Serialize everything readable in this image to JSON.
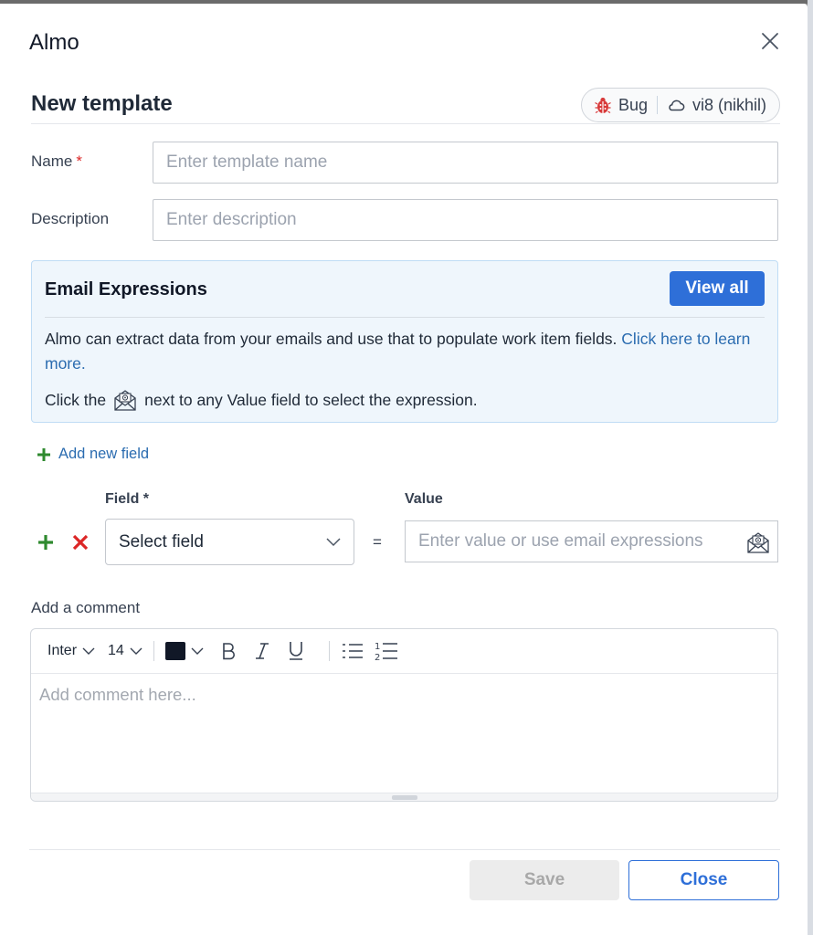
{
  "dialog": {
    "app_title": "Almo",
    "page_title": "New template",
    "context": {
      "item_type": "Bug",
      "item_type_icon": "bug-icon",
      "project": "vi8 (nikhil)",
      "project_icon": "cloud-icon"
    }
  },
  "form": {
    "name_label": "Name",
    "required_marker": "*",
    "name_placeholder": "Enter template name",
    "description_label": "Description",
    "description_placeholder": "Enter description"
  },
  "email_expressions": {
    "title": "Email Expressions",
    "view_all_label": "View all",
    "body_text": "Almo can extract data from your emails and use that to populate work item fields.",
    "link_text": "Click here to learn more.",
    "hint_prefix": "Click the",
    "hint_suffix": "next to any Value field to select the expression.",
    "hint_icon": "email-expression-icon"
  },
  "fields": {
    "add_label": "Add new field",
    "field_column_label": "Field *",
    "value_column_label": "Value",
    "select_placeholder": "Select field",
    "equals": "=",
    "value_placeholder": "Enter value or use email expressions"
  },
  "comment": {
    "label": "Add a comment",
    "placeholder": "Add comment here...",
    "toolbar": {
      "font_family": "Inter",
      "font_size": "14",
      "text_color": "#111827"
    }
  },
  "footer": {
    "save_label": "Save",
    "close_label": "Close"
  },
  "colors": {
    "primary": "#2e6fd8",
    "add_green": "#2f8a2f",
    "remove_red": "#dc2626",
    "info_bg": "#eff6fc"
  }
}
